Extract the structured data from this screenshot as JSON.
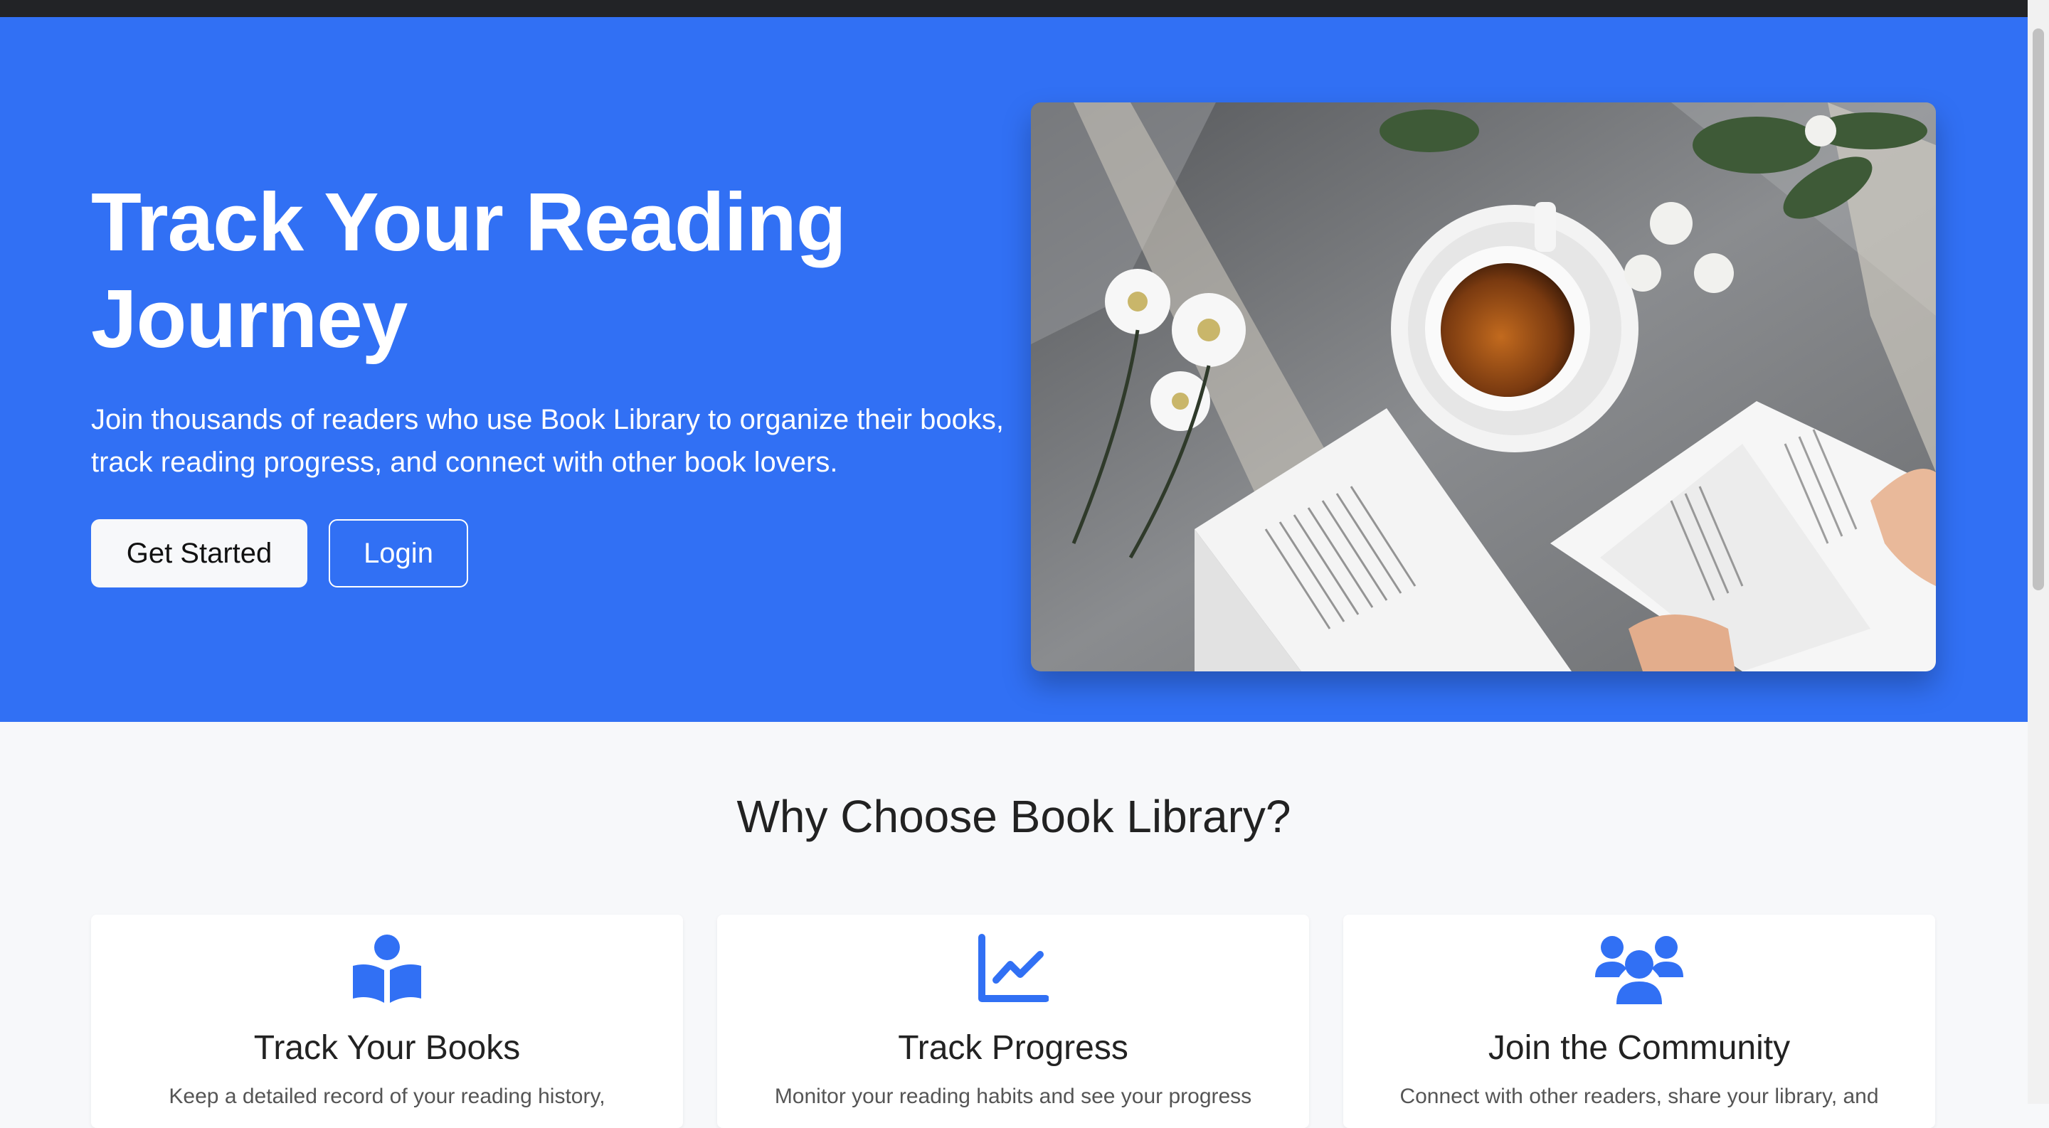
{
  "hero": {
    "title": "Track Your Reading Journey",
    "subtitle": "Join thousands of readers who use Book Library to organize their books, track reading progress, and connect with other book lovers.",
    "get_started_label": "Get Started",
    "login_label": "Login"
  },
  "features": {
    "title": "Why Choose Book Library?",
    "cards": [
      {
        "icon": "book-reader-icon",
        "title": "Track Your Books",
        "text": "Keep a detailed record of your reading history,"
      },
      {
        "icon": "chart-line-icon",
        "title": "Track Progress",
        "text": "Monitor your reading habits and see your progress"
      },
      {
        "icon": "users-icon",
        "title": "Join the Community",
        "text": "Connect with other readers, share your library, and"
      }
    ]
  },
  "colors": {
    "primary": "#3170f4",
    "background": "#f7f8fa",
    "top_bar": "#222326"
  }
}
